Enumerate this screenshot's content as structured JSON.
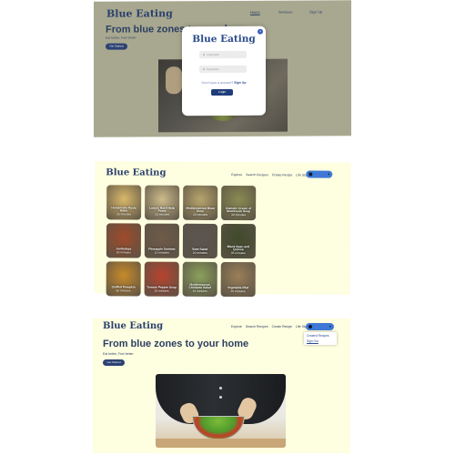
{
  "app": {
    "name": "Blue Eating"
  },
  "login_screen": {
    "nav": [
      "Home",
      "Services",
      "Sign Up"
    ],
    "hero_title": "From blue zones to your home",
    "hero_subtitle": "Eat better, Feel better",
    "cta_label": "Get Started",
    "modal": {
      "logo": "Blue Eating",
      "close_glyph": "×",
      "username_placeholder": "Username",
      "password_placeholder": "Password",
      "signup_prompt": "Don't have a account?",
      "signup_link": "Sign Up",
      "login_label": "Login"
    }
  },
  "grid_screen": {
    "nav": [
      "Explore",
      "Search Recipes",
      "Create Recipe",
      "Life Style"
    ],
    "recipes": [
      {
        "name": "Homemade Pasta Bake",
        "time": "25 minutes",
        "color": "#d9b86a"
      },
      {
        "name": "Lemon Basil Herb Pasta",
        "time": "15 minutes",
        "color": "#cdbb8a"
      },
      {
        "name": "Mediterranean Bean Soup",
        "time": "20 minutes",
        "color": "#b8a56c"
      },
      {
        "name": "Diabetic Cream of Mushroom Soup",
        "time": "30 minutes",
        "color": "#8a8a52"
      },
      {
        "name": "Jambalaya",
        "time": "30 minutes",
        "color": "#a04a2a"
      },
      {
        "name": "Pineapple Sashimi",
        "time": "10 minutes",
        "color": "#6f5a48"
      },
      {
        "name": "Beet Salad",
        "time": "20 minutes",
        "color": "#5c5550"
      },
      {
        "name": "Black Bean and Quinoa",
        "time": "35 minutes",
        "color": "#3f4a2a"
      },
      {
        "name": "Stuffed Pumpkin",
        "time": "60 minutes",
        "color": "#c88a2a"
      },
      {
        "name": "Tomato Pepper Soup",
        "time": "25 minutes",
        "color": "#b8432e"
      },
      {
        "name": "Mediterranean Chickpea Salad",
        "time": "15 minutes",
        "color": "#8aa05c"
      },
      {
        "name": "Vegetable Pilaf",
        "time": "30 minutes",
        "color": "#9a7f58"
      }
    ]
  },
  "landing_screen": {
    "nav": [
      "Explore",
      "Search Recipes",
      "Create Recipe",
      "Life Style"
    ],
    "hero_title": "From blue zones to your home",
    "hero_subtitle": "Eat better, Feel better",
    "cta_label": "Get Started",
    "dropdown": [
      "Created Recipes",
      "Sign Out"
    ]
  },
  "colors": {
    "brand": "#2a3f6d",
    "accent": "#3f78d6",
    "page_bg": "#fefee0"
  }
}
